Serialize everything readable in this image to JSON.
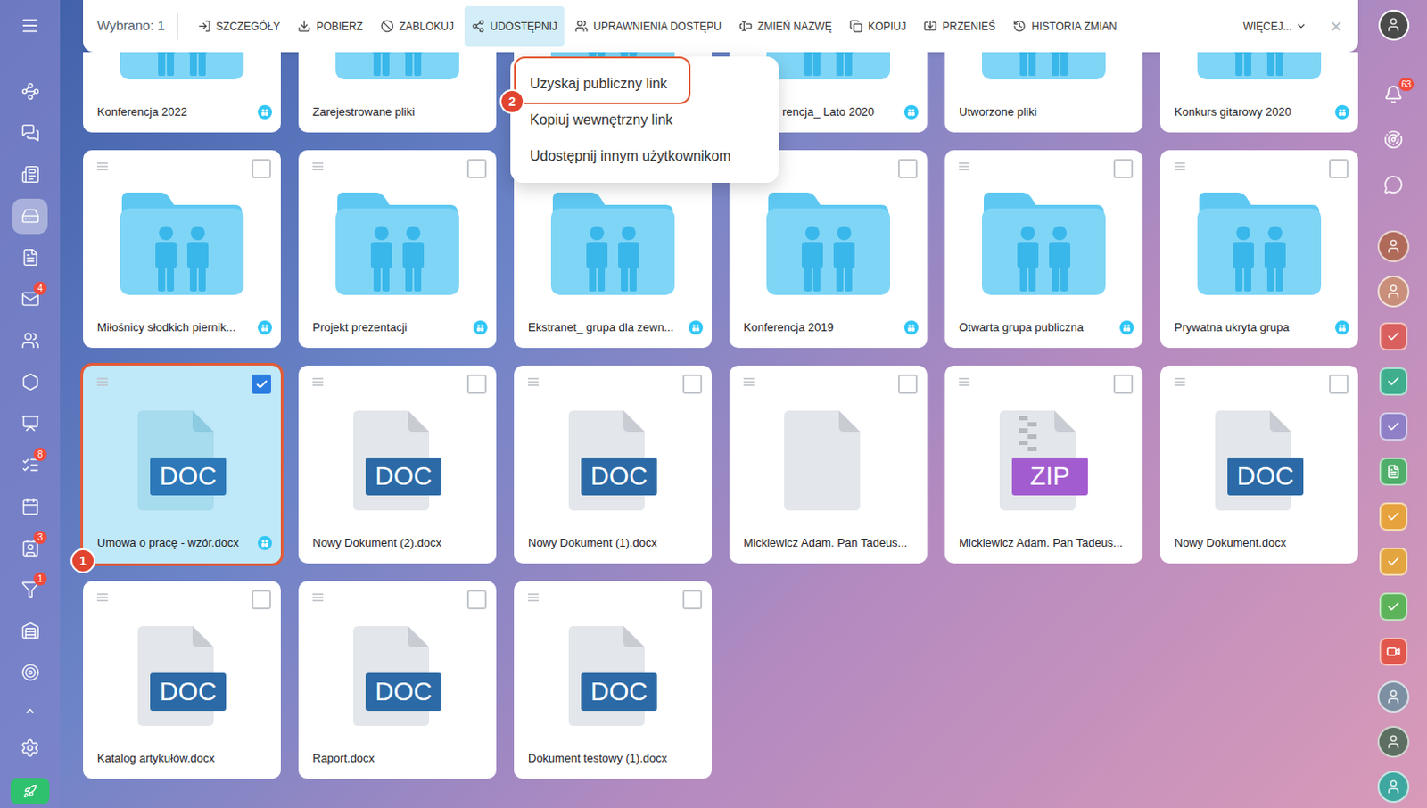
{
  "toolbar": {
    "selection": "Wybrano: 1",
    "actions": [
      {
        "label": "SZCZEGÓŁY",
        "selected": false
      },
      {
        "label": "POBIERZ",
        "selected": false
      },
      {
        "label": "ZABLOKUJ",
        "selected": false
      },
      {
        "label": "UDOSTĘPNIJ",
        "selected": true
      },
      {
        "label": "UPRAWNIENIA DOSTĘPU",
        "selected": false
      },
      {
        "label": "ZMIEŃ NAZWĘ",
        "selected": false
      },
      {
        "label": "KOPIUJ",
        "selected": false
      },
      {
        "label": "PRZENIEŚ",
        "selected": false
      },
      {
        "label": "HISTORIA ZMIAN",
        "selected": false
      }
    ],
    "more": "WIĘCEJ...",
    "close": "×"
  },
  "share_menu": {
    "items": [
      {
        "label": "Uzyskaj publiczny link",
        "highlighted": true,
        "step": "2"
      },
      {
        "label": "Kopiuj wewnętrzny link",
        "highlighted": false,
        "step": null
      },
      {
        "label": "Udostępnij innym użytkownikom",
        "highlighted": false,
        "step": null
      }
    ]
  },
  "rows": [
    {
      "partial": true,
      "cards": [
        {
          "label": "Konferencja 2022",
          "kind": "folder",
          "shared": true,
          "clipped": false
        },
        {
          "label": "Zarejestrowane pliki",
          "kind": "folder",
          "shared": false,
          "clipped": false
        },
        {
          "label": "",
          "kind": "folder",
          "shared": false,
          "clipped": false
        },
        {
          "label": "rencja_ Lato 2020",
          "kind": "folder",
          "shared": true,
          "clipped": true
        },
        {
          "label": "Utworzone pliki",
          "kind": "folder",
          "shared": false,
          "clipped": false
        },
        {
          "label": "Konkurs gitarowy 2020",
          "kind": "folder",
          "shared": true,
          "clipped": false
        }
      ]
    },
    {
      "partial": false,
      "cards": [
        {
          "label": "Miłośnicy słodkich piernik...",
          "kind": "folder",
          "shared": true,
          "checked": false,
          "selected": false,
          "step": null
        },
        {
          "label": "Projekt prezentacji",
          "kind": "folder",
          "shared": true,
          "checked": false,
          "selected": false,
          "step": null
        },
        {
          "label": "Ekstranet_ grupa dla zewn...",
          "kind": "folder",
          "shared": true,
          "checked": false,
          "selected": false,
          "step": null
        },
        {
          "label": "Konferencja 2019",
          "kind": "folder",
          "shared": true,
          "checked": false,
          "selected": false,
          "step": null
        },
        {
          "label": "Otwarta grupa publiczna",
          "kind": "folder",
          "shared": true,
          "checked": false,
          "selected": false,
          "step": null
        },
        {
          "label": "Prywatna ukryta grupa",
          "kind": "folder",
          "shared": true,
          "checked": false,
          "selected": false,
          "step": null
        }
      ]
    },
    {
      "partial": false,
      "cards": [
        {
          "label": "Umowa o pracę - wzór.docx",
          "kind": "document",
          "badge": "DOC",
          "color": "#2c78b8",
          "shared": true,
          "checked": true,
          "selected": true,
          "step": "1"
        },
        {
          "label": "Nowy Dokument (2).docx",
          "kind": "document",
          "badge": "DOC",
          "color": "#2b6aa6",
          "shared": false,
          "checked": false,
          "selected": false,
          "step": null
        },
        {
          "label": "Nowy Dokument (1).docx",
          "kind": "document",
          "badge": "DOC",
          "color": "#2b6aa6",
          "shared": false,
          "checked": false,
          "selected": false,
          "step": null
        },
        {
          "label": "Mickiewicz Adam. Pan Tadeus...",
          "kind": "blank",
          "shared": false,
          "checked": false,
          "selected": false,
          "step": null
        },
        {
          "label": "Mickiewicz Adam. Pan Tadeus...",
          "kind": "archive",
          "badge": "ZIP",
          "color": "#a35ccf",
          "shared": false,
          "checked": false,
          "selected": false,
          "step": null
        },
        {
          "label": "Nowy Dokument.docx",
          "kind": "document",
          "badge": "DOC",
          "color": "#2b6aa6",
          "shared": false,
          "checked": false,
          "selected": false,
          "step": null
        }
      ]
    },
    {
      "partial": false,
      "cards": [
        {
          "label": "Katalog artykułów.docx",
          "kind": "document",
          "badge": "DOC",
          "color": "#2b6aa6",
          "shared": false,
          "checked": false,
          "selected": false,
          "step": null
        },
        {
          "label": "Raport.docx",
          "kind": "document",
          "badge": "DOC",
          "color": "#2b6aa6",
          "shared": false,
          "checked": false,
          "selected": false,
          "step": null
        },
        {
          "label": "Dokument testowy (1).docx",
          "kind": "document",
          "badge": "DOC",
          "color": "#2b6aa6",
          "shared": false,
          "checked": false,
          "selected": false,
          "step": null
        }
      ]
    }
  ],
  "left_sidebar": {
    "items": [
      {
        "badge": null,
        "selected": false
      },
      {
        "badge": null,
        "selected": false
      },
      {
        "badge": null,
        "selected": false
      },
      {
        "badge": null,
        "selected": true
      },
      {
        "badge": null,
        "selected": false
      },
      {
        "badge": "4",
        "selected": false
      },
      {
        "badge": null,
        "selected": false
      },
      {
        "badge": null,
        "selected": false
      },
      {
        "badge": null,
        "selected": false
      },
      {
        "badge": "8",
        "selected": false
      },
      {
        "badge": null,
        "selected": false
      },
      {
        "badge": "3",
        "selected": false
      },
      {
        "badge": "1",
        "selected": false
      },
      {
        "badge": null,
        "selected": false
      },
      {
        "badge": null,
        "selected": false
      }
    ]
  },
  "right_sidebar": {
    "profile": {
      "color": "#4a4a4a"
    },
    "notifications_badge": "63",
    "items": [
      {
        "kind": "avatar",
        "color": "#b06a5a"
      },
      {
        "kind": "avatar",
        "color": "#c98f7a"
      },
      {
        "kind": "task",
        "color": "#d9605f"
      },
      {
        "kind": "task",
        "color": "#3fae8e"
      },
      {
        "kind": "task",
        "color": "#8f7fc7"
      },
      {
        "kind": "doc",
        "color": "#4fae6a"
      },
      {
        "kind": "task",
        "color": "#e6a23c"
      },
      {
        "kind": "task",
        "color": "#e3a53f"
      },
      {
        "kind": "task",
        "color": "#5db35a"
      },
      {
        "kind": "video",
        "color": "#e2574c"
      },
      {
        "kind": "avatar",
        "color": "#7d8fa3"
      },
      {
        "kind": "avatar",
        "color": "#5d6f60"
      },
      {
        "kind": "avatar",
        "color": "#3ea7a0"
      }
    ]
  }
}
